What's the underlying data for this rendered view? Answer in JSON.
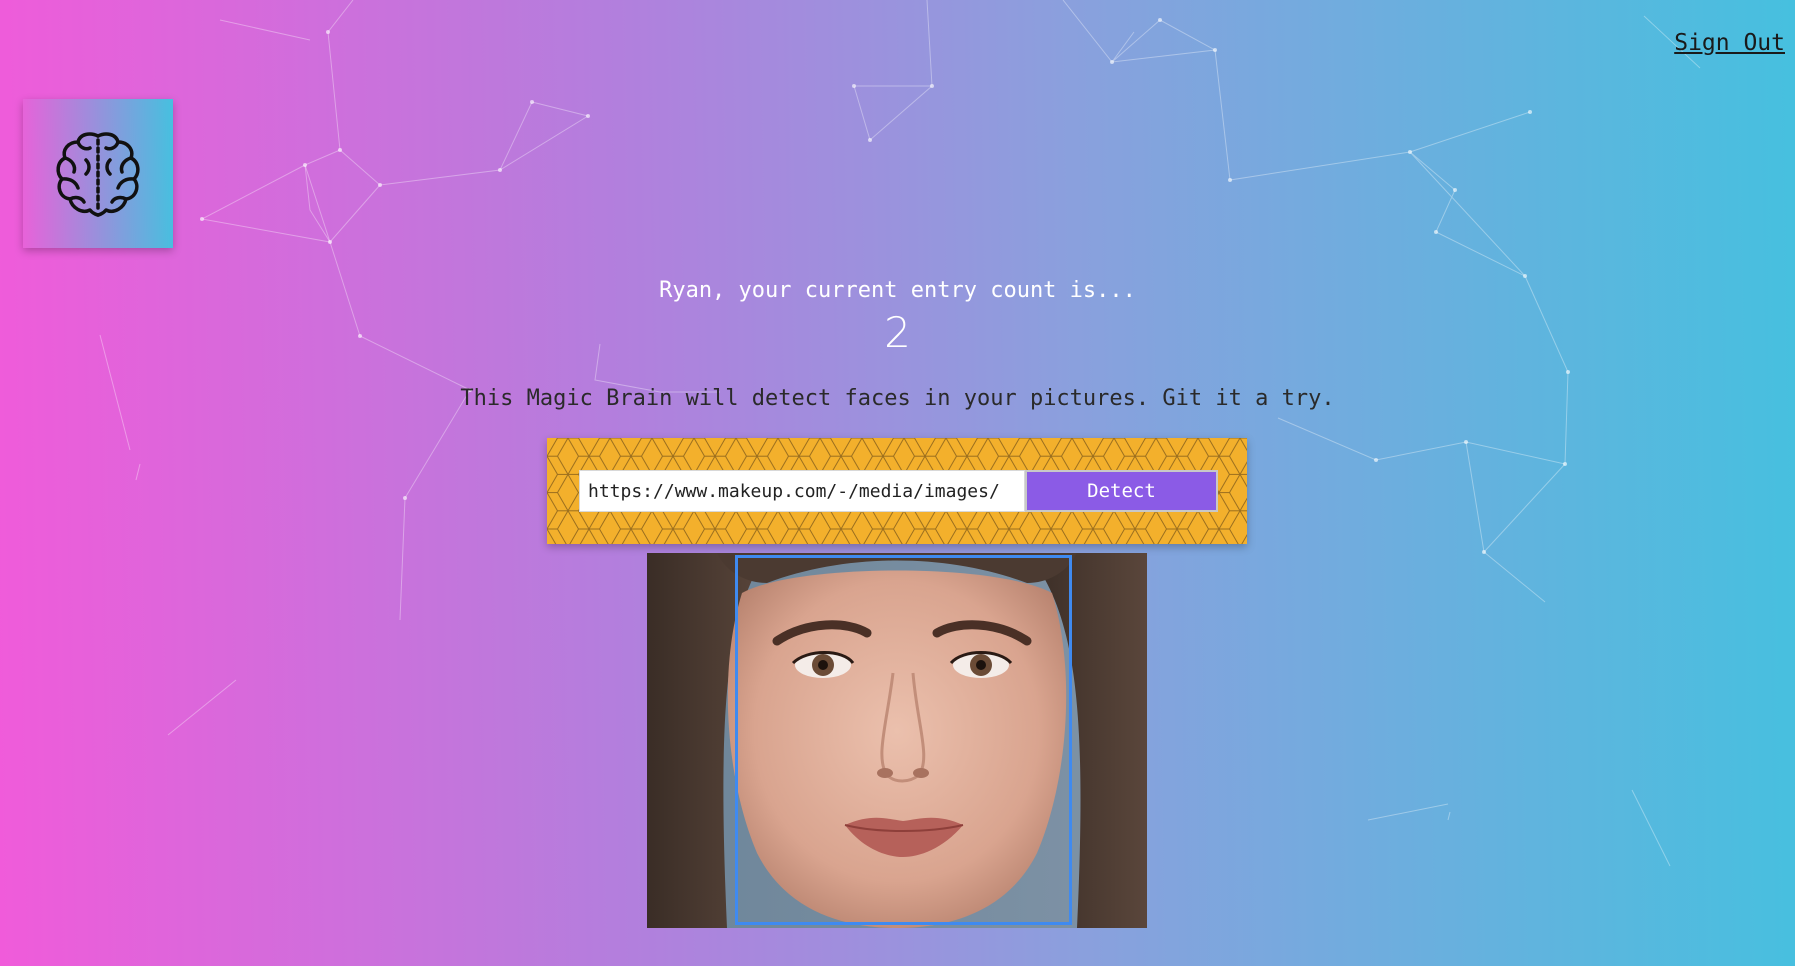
{
  "header": {
    "sign_out_label": "Sign Out"
  },
  "logo": {
    "icon": "brain-icon"
  },
  "rank": {
    "label": "Ryan, your current entry count is...",
    "count": "2"
  },
  "description": "This Magic Brain will detect faces in your pictures. Git it a try.",
  "image_form": {
    "url_value": "https://www.makeup.com/-/media/images/",
    "detect_label": "Detect"
  },
  "result": {
    "image": "face-photo",
    "face_box_color": "#3f8af0"
  },
  "colors": {
    "gradient_left": "#f05bda",
    "gradient_right": "#46c0df",
    "panel": "#f3b02c",
    "button": "#8b5be6"
  }
}
